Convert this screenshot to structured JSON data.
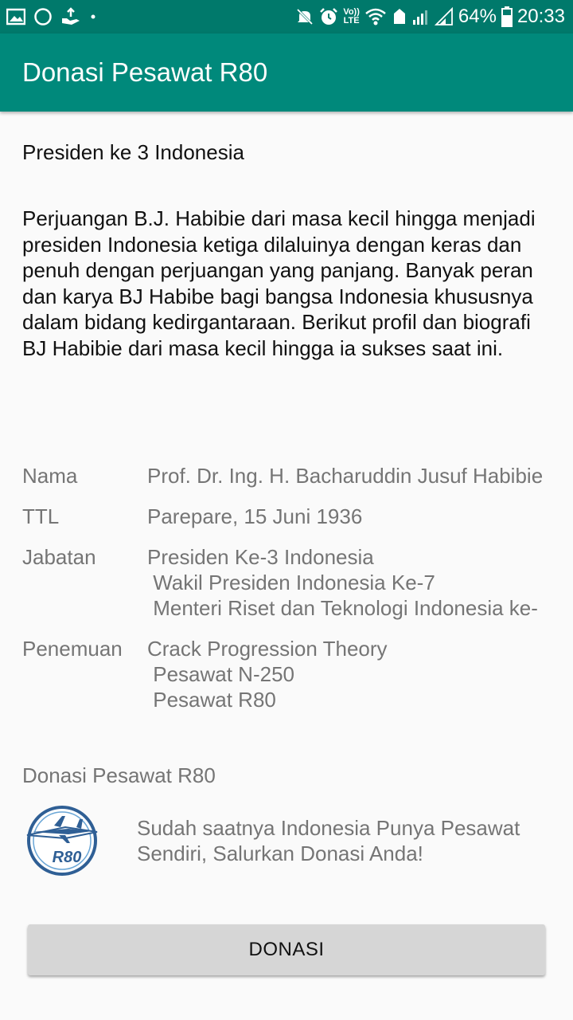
{
  "statusbar": {
    "left_icons": [
      "image-icon",
      "circle-icon",
      "hand-icon",
      "dot-icon"
    ],
    "right_icons": [
      "mute-icon",
      "alarm-icon",
      "volte-icon",
      "wifi-icon",
      "sync-icon",
      "signal-icon",
      "signal-2-icon",
      "battery-icon"
    ],
    "volte_top": "Vo))",
    "volte_bottom": "LTE",
    "battery": "64%",
    "time": "20:33"
  },
  "appbar": {
    "title": "Donasi Pesawat R80"
  },
  "content": {
    "subtitle": "Presiden ke 3 Indonesia",
    "description": "Perjuangan B.J. Habibie dari masa kecil hingga menjadi presiden Indonesia ketiga dilaluinya dengan keras dan penuh dengan perjuangan yang panjang. Banyak peran dan karya BJ Habibe bagi bangsa Indonesia khususnya dalam bidang kedirgantaraan. Berikut profil dan biografi BJ Habibie dari masa kecil hingga ia sukses saat ini.",
    "profile": [
      {
        "label": "Nama",
        "value": "Prof. Dr. Ing. H. Bacharuddin Jusuf Habibie"
      },
      {
        "label": "TTL",
        "value": "Parepare, 15 Juni 1936"
      },
      {
        "label": "Jabatan",
        "value": "Presiden Ke-3 Indonesia\n Wakil Presiden Indonesia Ke-7\n Menteri Riset dan Teknologi Indonesia ke-"
      },
      {
        "label": "Penemuan",
        "value": "Crack Progression Theory\n Pesawat N-250\n Pesawat R80"
      }
    ],
    "donasi_heading": "Donasi Pesawat R80",
    "logo_text": "R80",
    "promo_text": "Sudah saatnya Indonesia Punya Pesawat Sendiri, Salurkan Donasi Anda!",
    "button_label": "DONASI"
  },
  "colors": {
    "statusbar": "#00796b",
    "appbar": "#00897b",
    "button": "#d6d6d6",
    "secondary_text": "#757575"
  }
}
